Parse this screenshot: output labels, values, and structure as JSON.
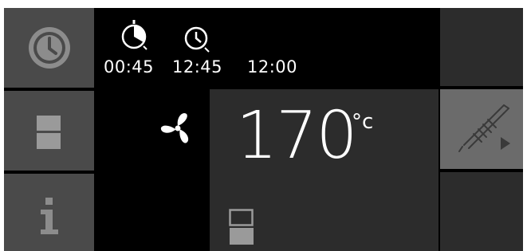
{
  "timers": [
    {
      "icon": "duration-timer-icon",
      "time": "00:45"
    },
    {
      "icon": "end-time-clock-icon",
      "time": "12:45"
    },
    {
      "time": "12:00"
    }
  ],
  "oven": {
    "temperature": "170",
    "unit": "°c",
    "mode_icon": "fan-icon"
  },
  "sidebar": {
    "items": [
      {
        "icon": "clock-icon"
      },
      {
        "icon": "oven-door-icon"
      },
      {
        "icon": "info-icon"
      }
    ]
  },
  "right_panel": {
    "probe_icon": "meat-probe-icon"
  },
  "colors": {
    "tile_grey": "#4a4a4a",
    "tile_dark": "#2c2c2c",
    "tile_light": "#6b6b6b",
    "text": "#ffffff",
    "icon_grey": "#8c8c8c"
  }
}
